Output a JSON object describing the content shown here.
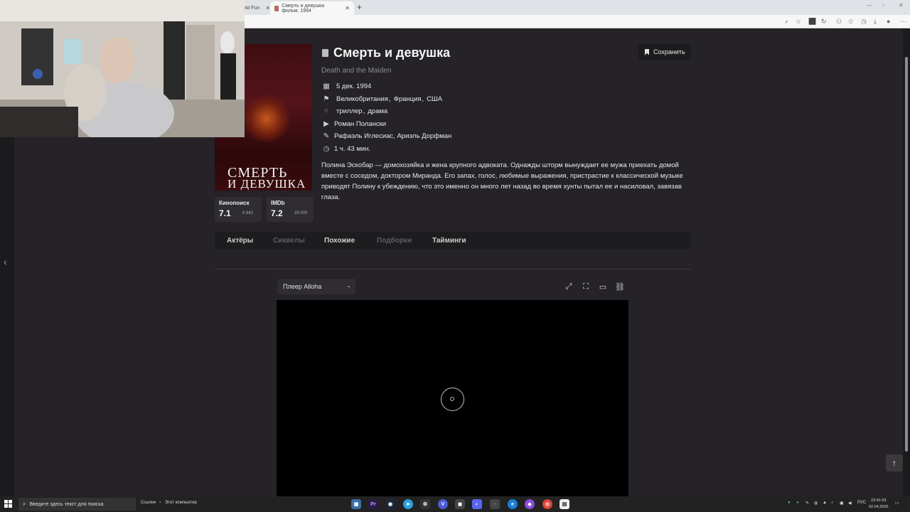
{
  "browser": {
    "tabs": [
      {
        "label": "ost Fun",
        "active": false
      },
      {
        "label": "Смерть и девушка фильм, 1994",
        "active": true
      }
    ],
    "new_tab": "+"
  },
  "movie": {
    "title": "Смерть и девушка",
    "original_title": "Death and the Maiden",
    "save_label": "Сохранить",
    "date": "5 дек. 1994",
    "countries": [
      "Великобритания",
      "Франция",
      "США"
    ],
    "genres": [
      "триллер",
      "драма"
    ],
    "director": "Роман Полански",
    "writers": "Рафаэль Иглесиас, Ариэль Дорфман",
    "duration": "1 ч. 43 мин.",
    "description": "Полина Эскобар — домохозяйка и жена крупного адвоката. Однажды шторм вынуждает ее мужа приехать домой вместе с соседом, доктором Миранда. Его запах, голос, любимые выражения, пристрастие к классической музыке приводят Полину к убеждению, что это именно он много лет назад во время хунты пытал ее и насиловал, завязав глаза.",
    "poster": {
      "line1": "СМЕРТЬ",
      "line2": "И ДЕВУШКА"
    },
    "ratings": [
      {
        "source": "Кинопоиск",
        "value": "7.1",
        "votes": "6 842"
      },
      {
        "source": "IMDb",
        "value": "7.2",
        "votes": "29 000"
      }
    ]
  },
  "content_tabs": [
    {
      "label": "Актёры",
      "enabled": true
    },
    {
      "label": "Сиквелы",
      "enabled": false
    },
    {
      "label": "Похожие",
      "enabled": true
    },
    {
      "label": "Подборки",
      "enabled": false
    },
    {
      "label": "Тайминги",
      "enabled": true
    }
  ],
  "player": {
    "selected": "Плеер Alloha",
    "buttons": [
      "expand-icon",
      "fullscreen-icon",
      "comment-icon",
      "link-icon"
    ]
  },
  "taskbar": {
    "search_placeholder": "Введите здесь текст для поиска",
    "links_label": "Ссылки",
    "computer_label": "Этот компьютер",
    "language": "РУС",
    "time": "23:41:03",
    "date": "02.04.2026"
  },
  "colors": {
    "page_bg": "#252327",
    "panel_bg": "#1d1c1e",
    "text_primary": "#f5f5f5",
    "text_muted": "#8c8c8c",
    "tab_disabled": "#5f5d60",
    "tab_enabled": "#cfcfcf"
  }
}
